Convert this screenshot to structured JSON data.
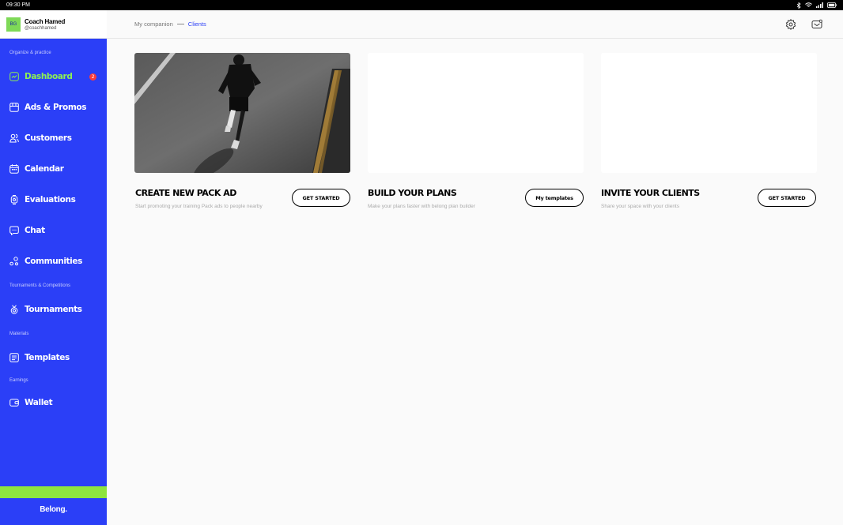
{
  "status_bar": {
    "time": "09:30 PM"
  },
  "profile": {
    "initials": "BG",
    "name": "Coach Hamed",
    "handle": "@coachhamed"
  },
  "sidebar": {
    "sections": [
      "Organize & practice",
      "Tournaments & Competitions",
      "Materials",
      "Earnings"
    ],
    "items": [
      {
        "label": "Dashboard",
        "icon": "dashboard-icon",
        "badge": "2",
        "active": true
      },
      {
        "label": "Ads & Promos",
        "icon": "ads-icon"
      },
      {
        "label": "Customers",
        "icon": "customers-icon"
      },
      {
        "label": "Calendar",
        "icon": "calendar-icon"
      },
      {
        "label": "Evaluations",
        "icon": "evaluations-icon"
      },
      {
        "label": "Chat",
        "icon": "chat-icon"
      },
      {
        "label": "Communities",
        "icon": "communities-icon"
      },
      {
        "label": "Tournaments",
        "icon": "tournaments-icon"
      },
      {
        "label": "Templates",
        "icon": "templates-icon"
      },
      {
        "label": "Wallet",
        "icon": "wallet-icon"
      }
    ],
    "brand": "Belong."
  },
  "breadcrumb": {
    "parent": "My companion",
    "current": "Clients"
  },
  "cards": [
    {
      "title": "CREATE NEW PACK AD",
      "subtitle": "Start promoting your training Pack ads to people nearby",
      "button": "GET STARTED"
    },
    {
      "title": "BUILD YOUR PLANS",
      "subtitle": "Make your plans faster with belong plan builder",
      "button": "My templates"
    },
    {
      "title": "INVITE YOUR CLIENTS",
      "subtitle": "Share your space with your clients",
      "button": "GET STARTED"
    }
  ],
  "colors": {
    "sidebar": "#2b3ff7",
    "accent_green": "#8df053",
    "badge": "#ff3b3b"
  }
}
